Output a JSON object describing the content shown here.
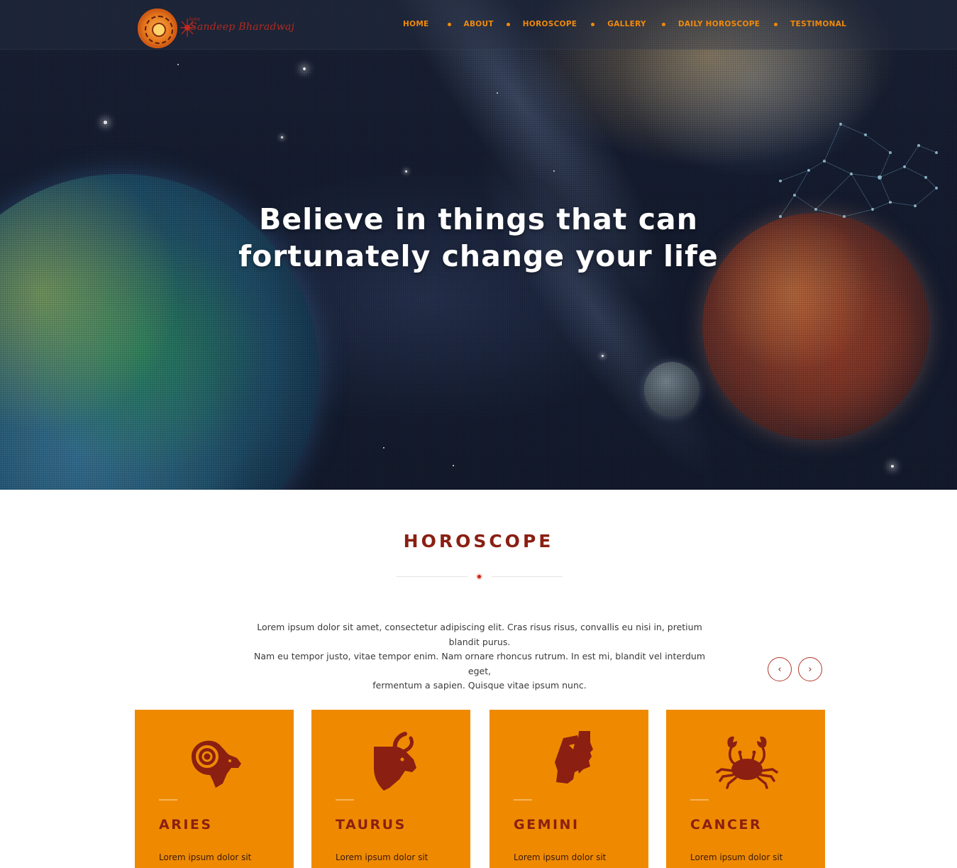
{
  "logo": {
    "name": "Sandeep Bharadwaj",
    "small_text": "Astro"
  },
  "nav": {
    "items": [
      {
        "label": "HOME"
      },
      {
        "label": "ABOUT"
      },
      {
        "label": "HOROSCOPE"
      },
      {
        "label": "GALLERY"
      },
      {
        "label": "DAILY HOROSCOPE"
      },
      {
        "label": "TESTIMONAL"
      }
    ]
  },
  "hero": {
    "line1": "Believe in things that can",
    "line2": "fortunately change your life"
  },
  "horoscope": {
    "title": "HOROSCOPE",
    "intro_line1": "Lorem ipsum dolor sit amet, consectetur adipiscing elit. Cras risus risus, convallis eu nisi in, pretium blandit purus.",
    "intro_line2": "Nam eu tempor justo, vitae tempor enim. Nam ornare rhoncus rutrum. In est mi, blandit vel interdum eget,",
    "intro_line3": "fermentum a sapien. Quisque vitae ipsum nunc.",
    "prev_icon": "chevron-left-icon",
    "next_icon": "chevron-right-icon",
    "prev_label": "‹",
    "next_label": "›",
    "cards": [
      {
        "name": "ARIES",
        "desc": "Lorem ipsum dolor sit",
        "icon": "ram-icon"
      },
      {
        "name": "TAURUS",
        "desc": "Lorem ipsum dolor sit",
        "icon": "bull-icon"
      },
      {
        "name": "GEMINI",
        "desc": "Lorem ipsum dolor sit",
        "icon": "twins-icon"
      },
      {
        "name": "CANCER",
        "desc": "Lorem ipsum dolor sit",
        "icon": "crab-icon"
      }
    ]
  },
  "colors": {
    "accent_orange": "#ef8a00",
    "nav_orange": "#f08a0c",
    "dark_red": "#8a1f12",
    "hero_bg": "#151d31"
  }
}
